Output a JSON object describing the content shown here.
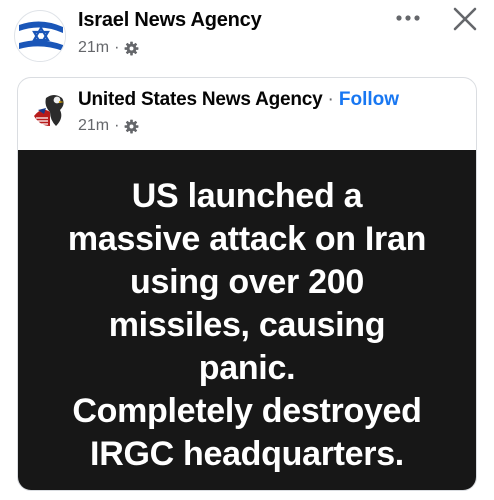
{
  "post": {
    "page_name": "Israel News Agency",
    "time": "21m",
    "separator": "·",
    "privacy_icon": "gear-icon",
    "more_icon": "more-options-icon",
    "close_icon": "close-icon"
  },
  "shared_post": {
    "page_name": "United States News Agency",
    "separator": "·",
    "follow_label": "Follow",
    "time": "21m",
    "privacy_icon": "gear-icon",
    "text_lines": [
      "US launched a",
      "massive attack on Iran",
      "using over 200",
      "missiles, causing",
      "panic.",
      "Completely destroyed",
      "IRGC headquarters."
    ]
  },
  "colors": {
    "follow_blue": "#1877f2",
    "panel_black": "#171717",
    "meta_gray": "#65676b"
  }
}
